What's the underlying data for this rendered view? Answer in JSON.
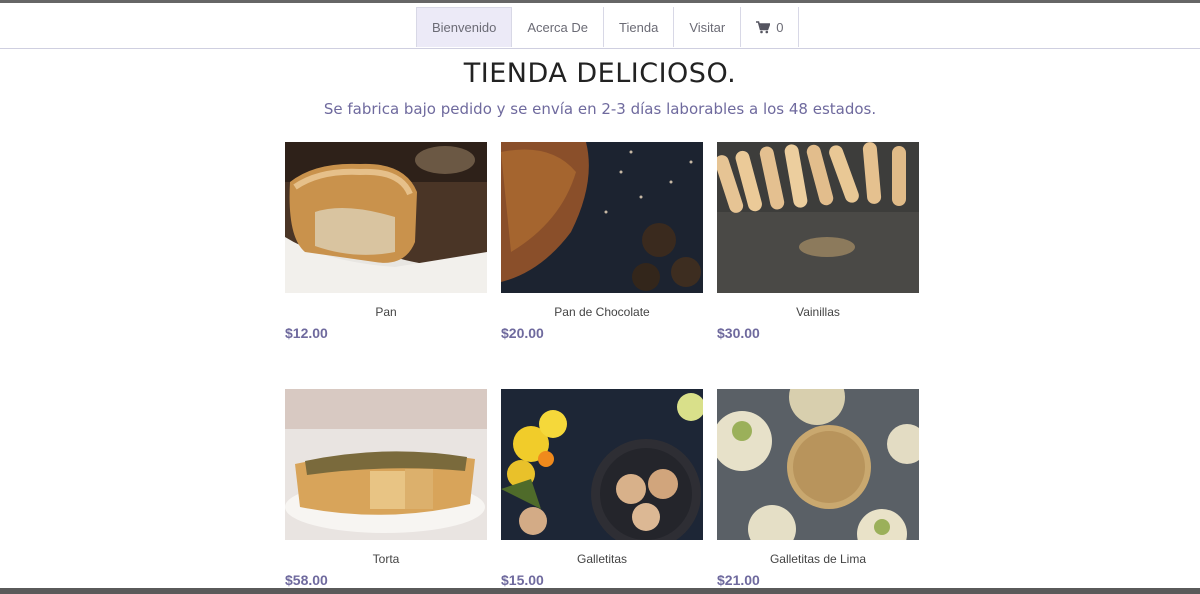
{
  "nav": {
    "items": [
      {
        "label": "Bienvenido",
        "active": true
      },
      {
        "label": "Acerca De",
        "active": false
      },
      {
        "label": "Tienda",
        "active": false
      },
      {
        "label": "Visitar",
        "active": false
      }
    ],
    "cart": {
      "icon": "shopping-cart-icon",
      "count": "0"
    }
  },
  "header": {
    "title": "TIENDA DELICIOSO.",
    "subtitle": "Se fabrica bajo pedido y se envía en 2-3 días laborables a los 48 estados."
  },
  "products": [
    {
      "name": "Pan",
      "price": "$12.00",
      "image": "bread-loaf-photo"
    },
    {
      "name": "Pan de Chocolate",
      "price": "$20.00",
      "image": "chocolate-bread-photo"
    },
    {
      "name": "Vainillas",
      "price": "$30.00",
      "image": "ladyfingers-photo"
    },
    {
      "name": "Torta",
      "price": "$58.00",
      "image": "tart-photo"
    },
    {
      "name": "Galletitas",
      "price": "$15.00",
      "image": "cookies-photo"
    },
    {
      "name": "Galletitas de Lima",
      "price": "$21.00",
      "image": "lime-cookies-photo"
    }
  ],
  "colors": {
    "accent": "#6f6a9e",
    "nav_active_bg": "#eceaf7"
  }
}
